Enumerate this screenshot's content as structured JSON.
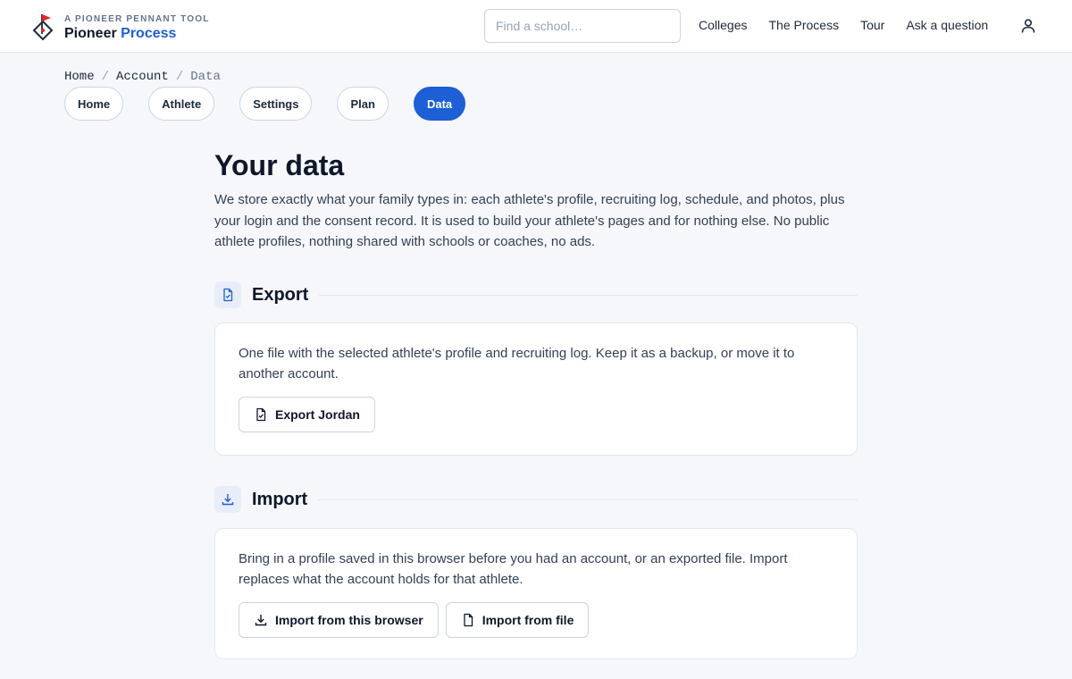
{
  "brand": {
    "kicker": "A PIONEER PENNANT TOOL",
    "name_part1": "Pioneer",
    "name_part2": "Process",
    "accent_color": "#1d5fd6"
  },
  "search": {
    "placeholder": "Find a school…"
  },
  "nav": {
    "items": [
      "Colleges",
      "The Process",
      "Tour",
      "Ask a question"
    ],
    "user_icon": "user-icon"
  },
  "breadcrumb": {
    "items": [
      "Home",
      "Account",
      "Data"
    ],
    "separator": "/"
  },
  "tabs": {
    "items": [
      "Home",
      "Athlete",
      "Settings",
      "Plan",
      "Data"
    ],
    "active": "Data"
  },
  "page": {
    "title": "Your data",
    "intro": "We store exactly what your family types in: each athlete's profile, recruiting log, schedule, and photos, plus your login and the consent record. It is used to build your athlete's pages and for nothing else. No public athlete profiles, nothing shared with schools or coaches, no ads."
  },
  "export": {
    "title": "Export",
    "icon": "file-check-icon",
    "description": "One file with the selected athlete's profile and recruiting log. Keep it as a backup, or move it to another account.",
    "button_label": "Export Jordan"
  },
  "import": {
    "title": "Import",
    "icon": "download-icon",
    "description": "Bring in a profile saved in this browser before you had an account, or an exported file. Import replaces what the account holds for that athlete.",
    "browser_button_label": "Import from this browser",
    "file_button_label": "Import from file"
  }
}
